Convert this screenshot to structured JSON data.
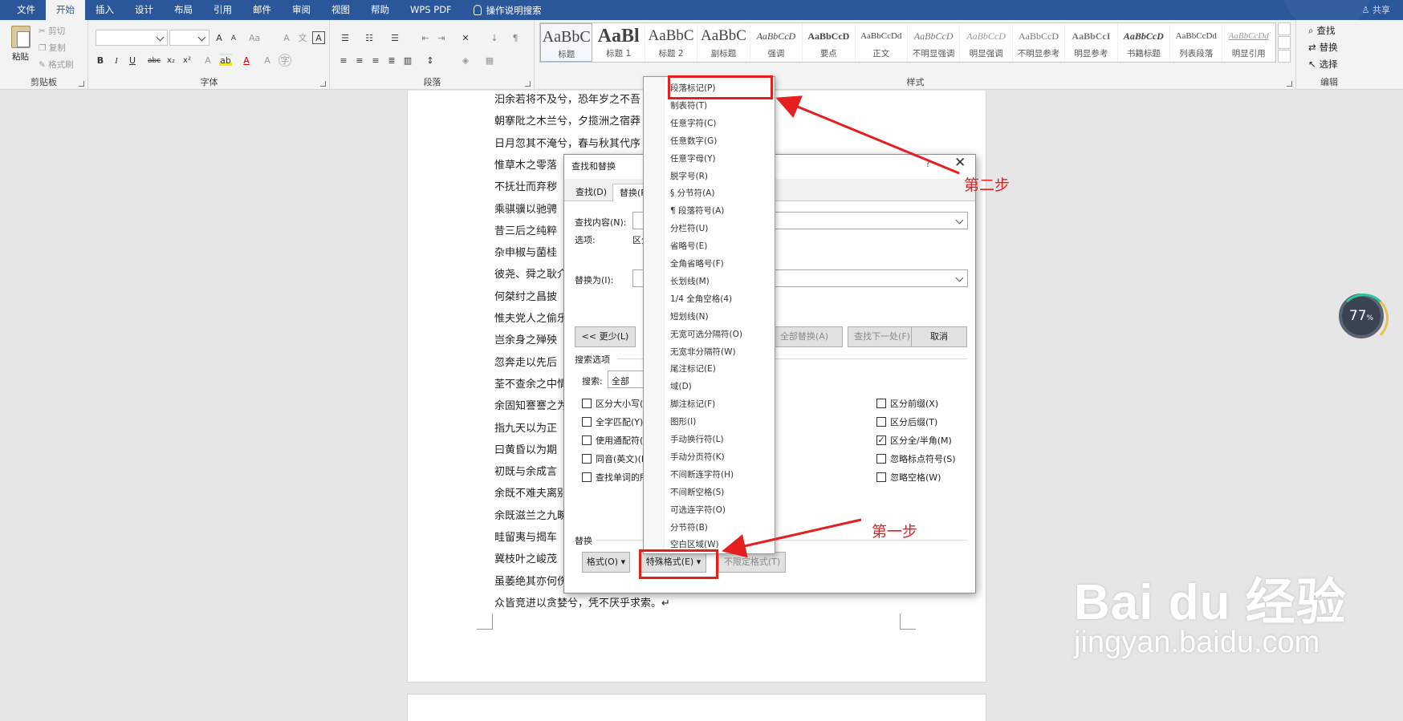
{
  "menubar": {
    "tabs": [
      "文件",
      "开始",
      "插入",
      "设计",
      "布局",
      "引用",
      "邮件",
      "审阅",
      "视图",
      "帮助",
      "WPS PDF"
    ],
    "active_tab": "开始",
    "tell_me": "操作说明搜索",
    "share": "共享"
  },
  "ribbon": {
    "clipboard": {
      "paste": "粘贴",
      "cut": "剪切",
      "copy": "复制",
      "format_painter": "格式刷",
      "label": "剪贴板"
    },
    "font": {
      "label": "字体"
    },
    "paragraph": {
      "label": "段落"
    },
    "styles": {
      "label": "样式",
      "items": [
        {
          "preview": "AaBbC",
          "name": "标题"
        },
        {
          "preview": "AaBl",
          "name": "标题 1"
        },
        {
          "preview": "AaBbC",
          "name": "标题 2"
        },
        {
          "preview": "AaBbC",
          "name": "副标题"
        },
        {
          "preview": "AaBbCcD",
          "name": "强调"
        },
        {
          "preview": "AaBbCcD",
          "name": "要点"
        },
        {
          "preview": "AaBbCcDd",
          "name": "正文"
        },
        {
          "preview": "AaBbCcD",
          "name": "不明显强调"
        },
        {
          "preview": "AaBbCcD",
          "name": "明显强调"
        },
        {
          "preview": "AaBbCcD",
          "name": "不明显参考"
        },
        {
          "preview": "AaBbCcI",
          "name": "明显参考"
        },
        {
          "preview": "AaBbCcD",
          "name": "书籍标题"
        },
        {
          "preview": "AaBbCcDd",
          "name": "列表段落"
        },
        {
          "preview": "AaBbCcDd",
          "name": "明显引用"
        }
      ]
    },
    "editing": {
      "find": "查找",
      "replace": "替换",
      "select": "选择",
      "label": "编辑"
    }
  },
  "document": {
    "lines": [
      "汩余若将不及兮，恐年岁之不吾",
      "朝搴阰之木兰兮，夕揽洲之宿莽",
      "日月忽其不淹兮，春与秋其代序",
      "惟草木之零落",
      "不抚壮而弃秽",
      "乘骐骥以驰骋",
      "昔三后之纯粹",
      "杂申椒与菌桂",
      "彼尧、舜之耿介",
      "何桀纣之昌披",
      "惟夫党人之偷乐",
      "岂余身之殚殃",
      "忽奔走以先后",
      "荃不查余之中情",
      "余固知謇謇之为",
      "指九天以为正",
      "曰黄昏以为期",
      "初既与余成言",
      "余既不难夫离别",
      "余既滋兰之九畹",
      "畦留夷与揭车",
      "冀枝叶之峻茂",
      "虽萎绝其亦何伤",
      "众皆竞进以贪婪兮，凭不厌乎求索。↵"
    ]
  },
  "zoom_badge": {
    "value": "77",
    "unit": "%"
  },
  "dialog": {
    "title": "查找和替换",
    "help": "?",
    "close": "✕",
    "tabs": [
      "查找(D)",
      "替换(P)"
    ],
    "find_label": "查找内容(N):",
    "options_label": "选项:",
    "options_value": "区分全/半角",
    "replace_label": "替换为(I):",
    "less_button": "<< 更少(L)",
    "replace_all_button": "全部替换(A)",
    "find_next_button": "查找下一处(F)",
    "cancel_button": "取消",
    "search_options_label": "搜索选项",
    "search_label": "搜索:",
    "search_value": "全部",
    "left_checks": [
      {
        "label": "区分大小写(H)",
        "checked": false
      },
      {
        "label": "全字匹配(Y)",
        "checked": false
      },
      {
        "label": "使用通配符(U)",
        "checked": false
      },
      {
        "label": "同音(英文)(K)",
        "checked": false
      },
      {
        "label": "查找单词的所有形式(英文)(W)",
        "checked": false
      }
    ],
    "right_checks": [
      {
        "label": "区分前缀(X)",
        "checked": false
      },
      {
        "label": "区分后缀(T)",
        "checked": false
      },
      {
        "label": "区分全/半角(M)",
        "checked": true
      },
      {
        "label": "忽略标点符号(S)",
        "checked": false
      },
      {
        "label": "忽略空格(W)",
        "checked": false
      }
    ],
    "replace_section_label": "替换",
    "format_button": "格式(O)",
    "special_button": "特殊格式(E)",
    "no_format_button": "不限定格式(T)"
  },
  "special_menu": {
    "items": [
      "段落标记(P)",
      "制表符(T)",
      "任意字符(C)",
      "任意数字(G)",
      "任意字母(Y)",
      "脱字号(R)",
      "§ 分节符(A)",
      "¶ 段落符号(A)",
      "分栏符(U)",
      "省略号(E)",
      "全角省略号(F)",
      "长划线(M)",
      "1/4 全角空格(4)",
      "短划线(N)",
      "无宽可选分隔符(O)",
      "无宽非分隔符(W)",
      "尾注标记(E)",
      "域(D)",
      "脚注标记(F)",
      "图形(I)",
      "手动换行符(L)",
      "手动分页符(K)",
      "不间断连字符(H)",
      "不间断空格(S)",
      "可选连字符(O)",
      "分节符(B)",
      "空白区域(W)"
    ]
  },
  "annotations": {
    "step1": "第一步",
    "step2": "第二步",
    "color": "#e51e1e"
  },
  "watermark": {
    "logo": "Bai du 经验",
    "url": "jingyan.baidu.com"
  }
}
